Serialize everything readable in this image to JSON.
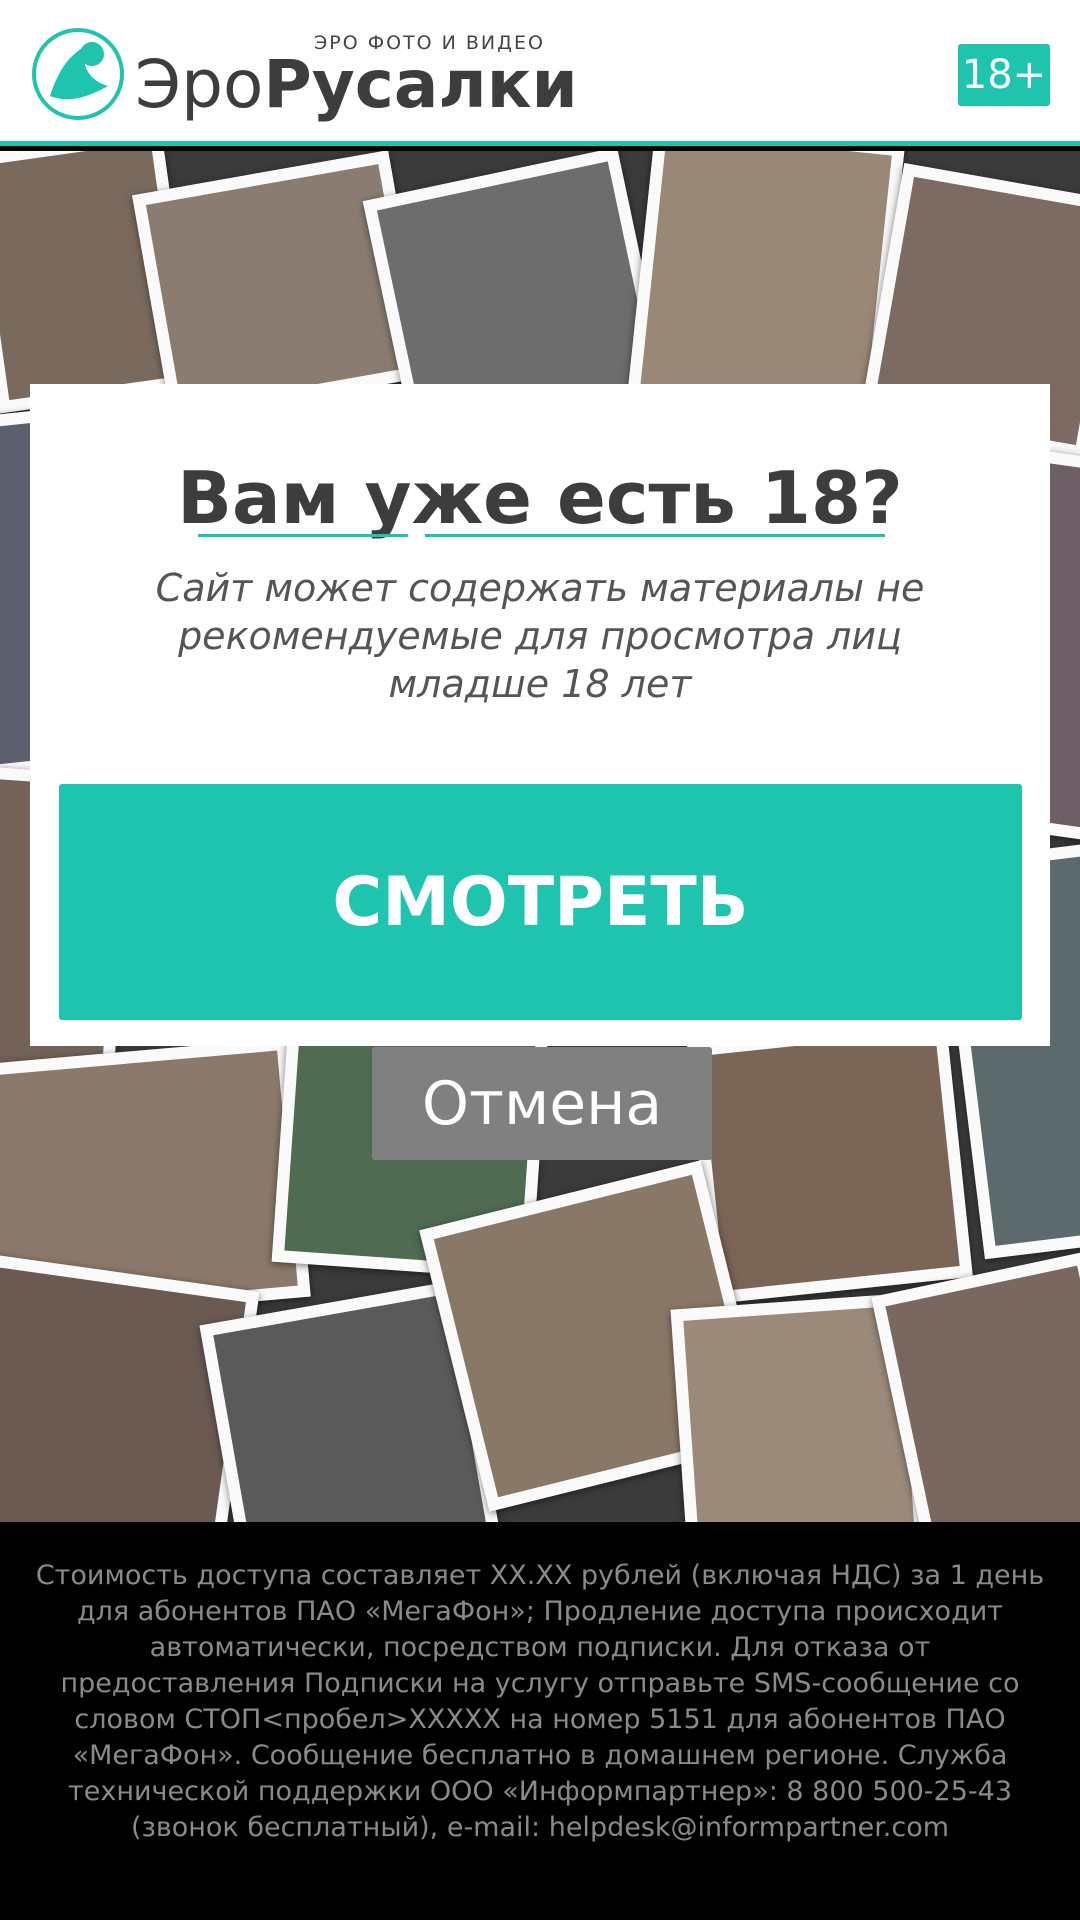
{
  "header": {
    "logo_subtitle": "ЭРО ФОТО И ВИДЕО",
    "logo_name_light": "Эро",
    "logo_name_bold": "Русалки",
    "age_badge": "18+"
  },
  "modal": {
    "title": "Вам уже есть 18?",
    "text": "Сайт может содержать материалы не рекомендуемые для просмотра лиц младше 18 лет",
    "watch_label": "СМОТРЕТЬ"
  },
  "cancel_label": "Отмена",
  "footer": {
    "text": "Стоимость доступа составляет XX.XX рублей (включая НДС) за 1 день для абонентов ПАО «МегаФон»; Продление доступа происходит автоматически, посредством подписки. Для отказа от предоставления Подписки на услугу отправьте SMS-сообщение со словом СТОП<пробел>XXXXX на номер 5151 для абонентов ПАО «МегаФон». Сообщение бесплатно в домашнем регионе. Служба технической поддержки ООО «Информпартнер»: 8 800 500-25-43 (звонок бесплатный), e-mail: helpdesk@informpartner.com"
  },
  "colors": {
    "accent": "#1ec4ad",
    "cancel": "#808080",
    "footer_bg": "#000000",
    "footer_text": "#8a8a8a"
  },
  "icons": {
    "logo": "mermaid-flower-icon"
  }
}
